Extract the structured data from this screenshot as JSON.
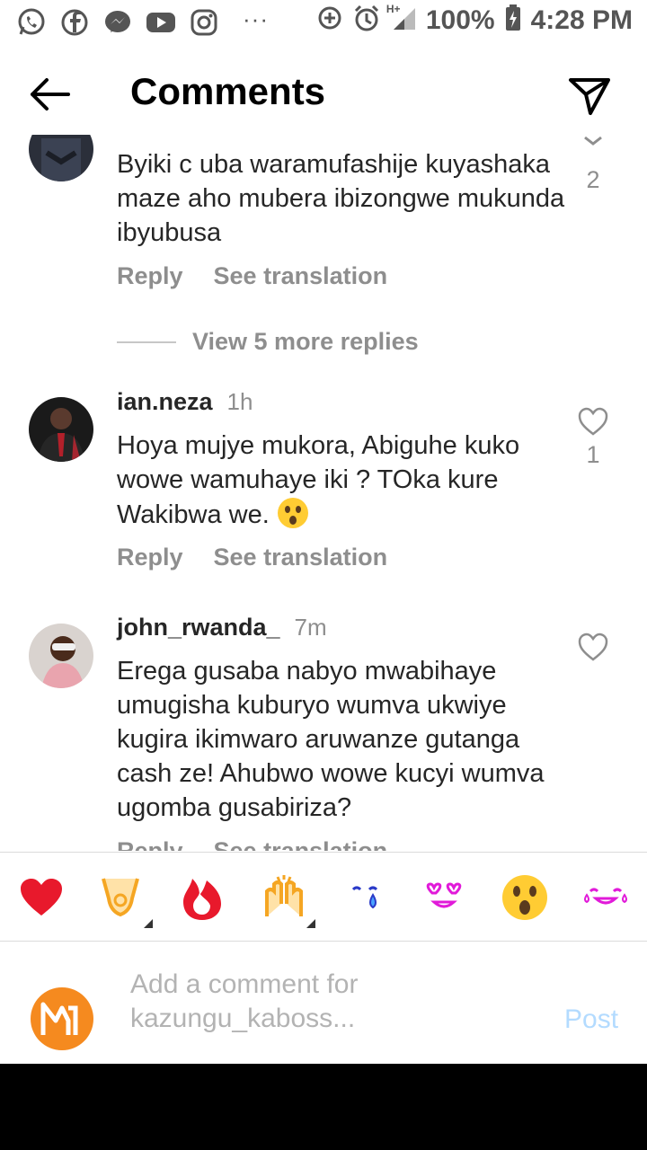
{
  "status_bar": {
    "battery": "100%",
    "time": "4:28 PM",
    "network": "H+",
    "icons": [
      "whatsapp-icon",
      "facebook-icon",
      "messenger-icon",
      "youtube-icon",
      "instagram-icon",
      "more-dots-icon",
      "data-saver-icon",
      "alarm-icon",
      "signal-icon",
      "battery-icon"
    ]
  },
  "header": {
    "title": "Comments"
  },
  "comments": [
    {
      "text": "Byiki c uba waramufashije kuyashaka maze aho mubera ibizongwe mukunda ibyubusa",
      "likes": "2",
      "reply_label": "Reply",
      "translate_label": "See translation"
    },
    {
      "username": "ian.neza",
      "time": "1h",
      "text": "Hoya mujye mukora, Abiguhe kuko wowe wamuhaye iki ? TOka kure Wakibwa we.",
      "emoji": "astonished-face",
      "likes": "1",
      "reply_label": "Reply",
      "translate_label": "See translation"
    },
    {
      "username": "john_rwanda_",
      "time": "7m",
      "text": "Erega gusaba nabyo mwabihaye umugisha kuburyo wumva ukwiye kugira ikimwaro aruwanze gutanga cash ze! Ahubwo wowe kucyi wumva ugomba gusabiriza?",
      "reply_label": "Reply",
      "translate_label": "See translation"
    }
  ],
  "view_more_replies": "View 5 more replies",
  "reactions": [
    "red-heart",
    "raising-hands",
    "fire",
    "clapping-hands",
    "crying-face",
    "heart-eyes",
    "astonished-face",
    "tears-of-joy"
  ],
  "composer": {
    "placeholder_line1": "Add a comment for",
    "placeholder_line2": "kazungu_kaboss...",
    "post_label": "Post"
  },
  "colors": {
    "text": "#262626",
    "muted": "#8e8e8e",
    "post_disabled": "#b3dbff",
    "avatar_orange": "#f58a1f"
  }
}
